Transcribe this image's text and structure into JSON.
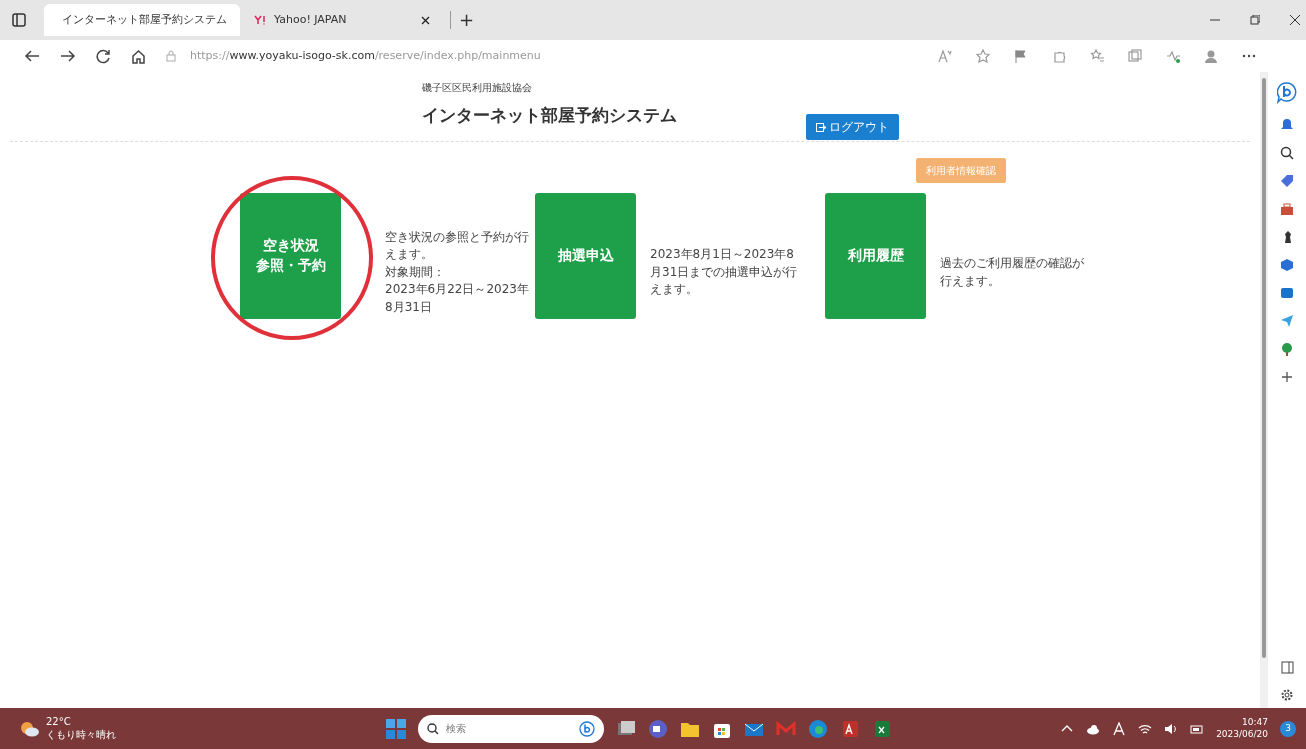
{
  "browser": {
    "tabs": [
      {
        "title": "インターネット部屋予約システム",
        "kind": "page",
        "selected": true
      },
      {
        "title": "Yahoo! JAPAN",
        "kind": "yahoo",
        "selected": false
      }
    ],
    "new_tab": "+",
    "address": {
      "scheme": "https://",
      "host": "www.yoyaku-isogo-sk.com",
      "path": "/reserve/index.php/mainmenu"
    }
  },
  "page": {
    "organization": "磯子区区民利用施設協会",
    "title": "インターネット部屋予約システム",
    "logout_button": "ログアウト",
    "user_info_button": "利用者情報確認",
    "menu_items": [
      {
        "label_lines": [
          "空き状況",
          "参照・予約"
        ],
        "description": [
          "空き状況の参照と予約が行えます。",
          "対象期間：",
          "2023年6月22日～2023年8月31日"
        ],
        "circled": true
      },
      {
        "label_lines": [
          "抽選申込"
        ],
        "description": [
          "2023年8月1日～2023年8月31日までの抽選申込が行えます。"
        ],
        "circled": false
      },
      {
        "label_lines": [
          "利用履歴"
        ],
        "description": [
          "過去のご利用履歴の確認が行えます。"
        ],
        "circled": false
      }
    ]
  },
  "taskbar": {
    "weather": {
      "temperature": "22°C",
      "condition": "くもり時々晴れ"
    },
    "search": {
      "placeholder": "検索"
    },
    "time": "10:47",
    "date": "2023/06/20",
    "notification_count": "3"
  }
}
